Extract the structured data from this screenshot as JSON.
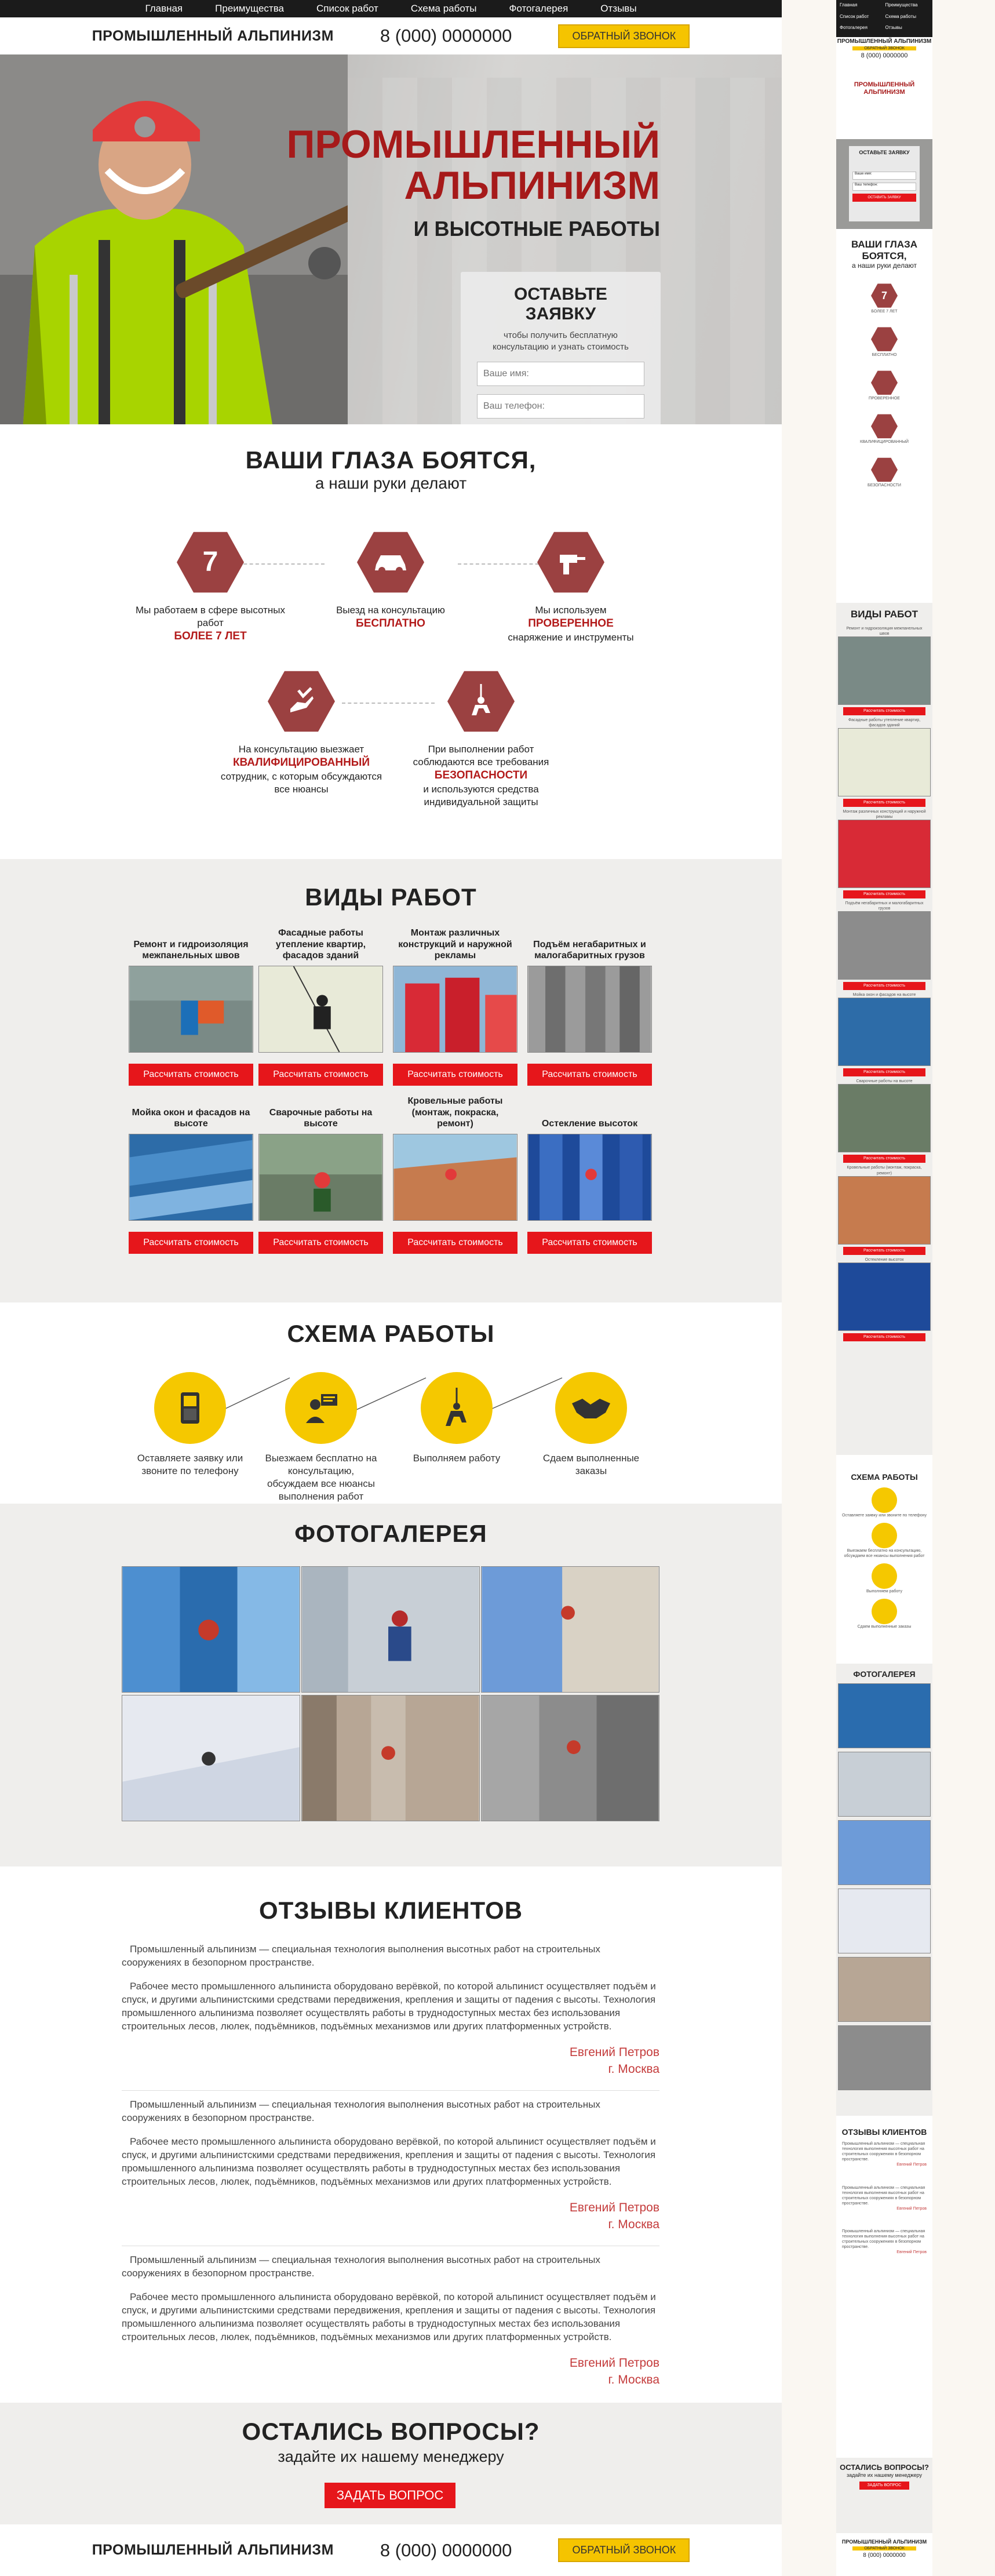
{
  "nav": [
    "Главная",
    "Преимущества",
    "Список работ",
    "Схема работы",
    "Фотогалерея",
    "Отзывы"
  ],
  "brand": "ПРОМЫШЛЕННЫЙ АЛЬПИНИЗМ",
  "phone": "8 (000) 0000000",
  "callback": "ОБРАТНЫЙ ЗВОНОК",
  "hero": {
    "title_line1": "ПРОМЫШЛЕННЫЙ",
    "title_line2": "АЛЬПИНИЗМ",
    "subtitle": "И ВЫСОТНЫЕ РАБОТЫ",
    "form_title": "ОСТАВЬТЕ ЗАЯВКУ",
    "form_text": "чтобы получить бесплатную консультацию и узнать стоимость",
    "name_placeholder": "Ваше имя:",
    "phone_placeholder": "Ваш телефон:",
    "submit": "ОСТАВИТЬ ЗАЯВКУ"
  },
  "advantages": {
    "title": "ВАШИ ГЛАЗА БОЯТСЯ,",
    "subtitle": "а наши руки делают",
    "items": [
      {
        "pre": "Мы работаем в сфере высотных работ",
        "accent": "БОЛЕЕ 7 ЛЕТ",
        "post": "",
        "icon": "7"
      },
      {
        "pre": "Выезд на консультацию",
        "accent": "БЕСПЛАТНО",
        "post": "",
        "icon": "car"
      },
      {
        "pre": "Мы используем",
        "accent": "ПРОВЕРЕННОЕ",
        "post": "снаряжение и инструменты",
        "icon": "drill"
      },
      {
        "pre": "На консультацию выезжает",
        "accent": "КВАЛИФИЦИРОВАННЫЙ",
        "post": "сотрудник, с которым обсуждаются все нюансы",
        "icon": "hand"
      },
      {
        "pre": "При выполнении работ соблюдаются все требования",
        "accent": "БЕЗОПАСНОСТИ",
        "post": "и используются средства индивидуальной защиты",
        "icon": "climber"
      }
    ]
  },
  "works": {
    "title": "ВИДЫ РАБОТ",
    "button": "Рассчитать стоимость",
    "items": [
      "Ремонт и гидроизоляция межпанельных швов",
      "Фасадные работы утепление квартир, фасадов зданий",
      "Монтаж различных конструкций и наружной рекламы",
      "Подъём негабаритных и малогабаритных грузов",
      "Мойка окон и фасадов на высоте",
      "Сварочные работы на высоте",
      "Кровельные работы (монтаж, покраска, ремонт)",
      "Остекление высоток"
    ]
  },
  "scheme": {
    "title": "СХЕМА РАБОТЫ",
    "steps": [
      "Оставляете заявку или звоните по телефону",
      "Выезжаем бесплатно на консультацию, обсуждаем все нюансы выполнения работ",
      "Выполняем работу",
      "Сдаем выполненные заказы"
    ]
  },
  "gallery": {
    "title": "ФОТОГАЛЕРЕЯ"
  },
  "reviews": {
    "title": "ОТЗЫВЫ КЛИЕНТОВ",
    "p1": "Промышленный альпинизм — специальная технология выполнения высотных работ на строительных сооружениях в безопорном пространстве.",
    "p2": "Рабочее место промышленного альпиниста оборудовано верёвкой, по которой альпинист осуществляет подъём и спуск, и другими альпинистскими средствами передвижения, крепления и защиты от падения с высоты. Технология промышленного альпинизма позволяет осуществлять работы в труднодоступных местах без использования строительных лесов, люлек, подъёмников, подъёмных механизмов или других платформенных устройств.",
    "author": "Евгений Петров",
    "city": "г. Москва"
  },
  "questions": {
    "title": "ОСТАЛИСЬ ВОПРОСЫ?",
    "subtitle": "задайте их нашему менеджеру",
    "button": "ЗАДАТЬ ВОПРОС"
  },
  "mobile": {
    "nav": [
      "Главная",
      "Преимущества",
      "Список работ",
      "Схема работы",
      "Фотогалерея",
      "Отзывы"
    ],
    "questions_title": "ОСТАЛИСЬ ВОПРОСЫ?",
    "questions_sub": "задайте их нашему менеджеру",
    "works_title": "ВИДЫ РАБОТ"
  },
  "colors": {
    "accent_red": "#e6161b",
    "dark_red": "#9b4141",
    "yellow": "#f5c400",
    "dark": "#1b1b1b"
  }
}
